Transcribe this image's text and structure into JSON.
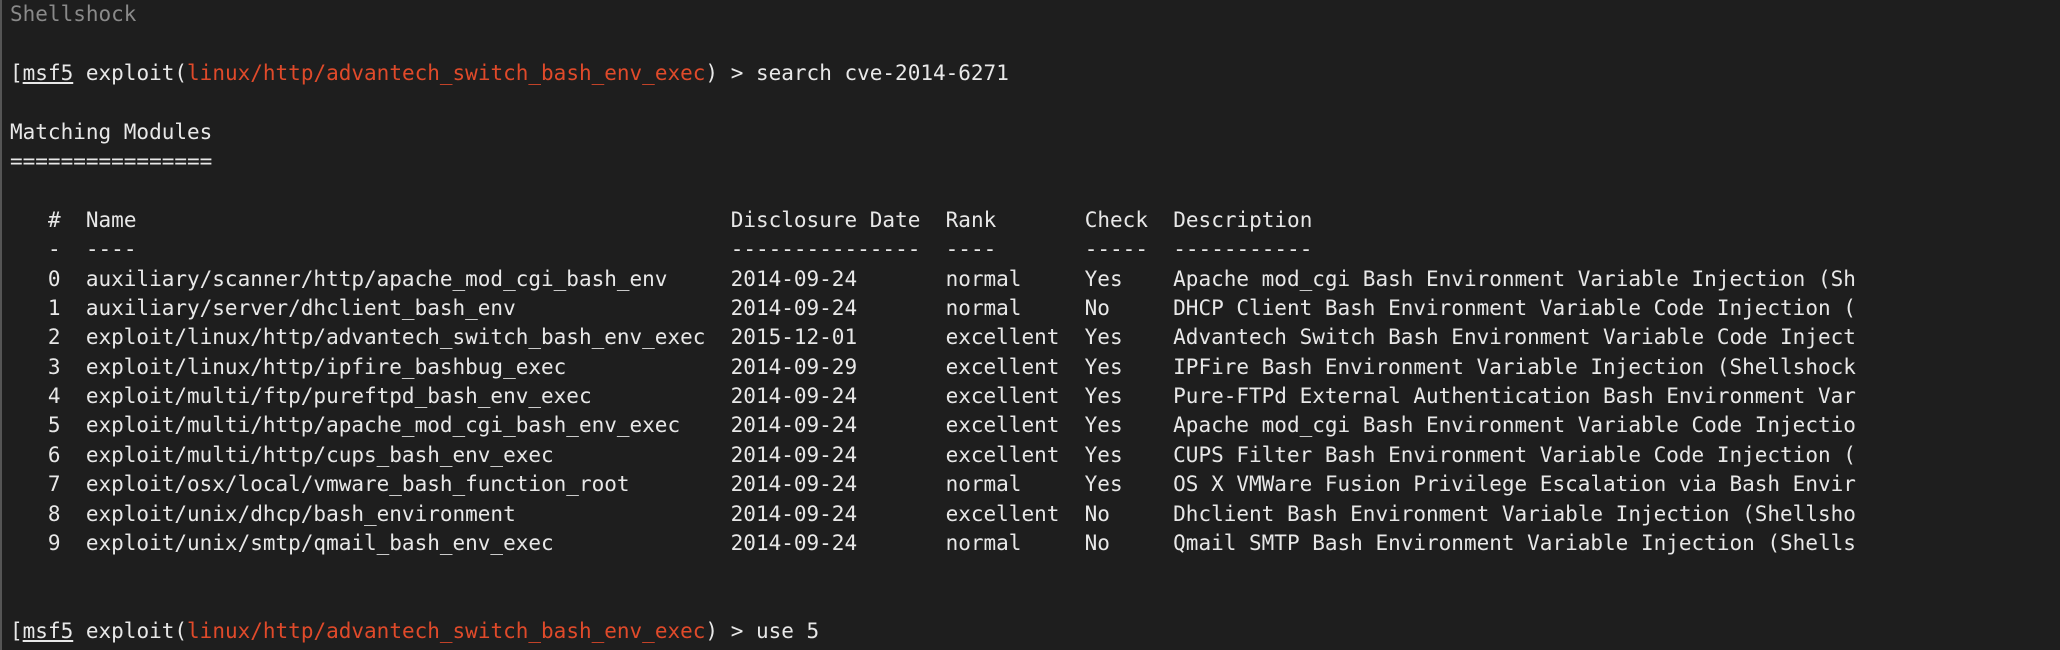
{
  "prev_output_tail": "  Shellshock",
  "prompt1": {
    "bracket_open": "[",
    "msf": "msf5",
    "exploit": " exploit(",
    "path": "linux/http/advantech_switch_bash_env_exec",
    "close": ") > ",
    "command": "search cve-2014-6271"
  },
  "heading": "Matching Modules",
  "heading_underline": "================",
  "columns": {
    "idx_header": "#",
    "idx_underline": "-",
    "name_header": "Name",
    "name_underline": "----",
    "date_header": "Disclosure Date",
    "date_underline": "---------------",
    "rank_header": "Rank",
    "rank_underline": "----",
    "check_header": "Check",
    "check_underline": "-----",
    "desc_header": "Description",
    "desc_underline": "-----------"
  },
  "rows": [
    {
      "idx": "0",
      "name": "auxiliary/scanner/http/apache_mod_cgi_bash_env",
      "date": "2014-09-24",
      "rank": "normal",
      "check": "Yes",
      "desc": "Apache mod_cgi Bash Environment Variable Injection (Sh"
    },
    {
      "idx": "1",
      "name": "auxiliary/server/dhclient_bash_env",
      "date": "2014-09-24",
      "rank": "normal",
      "check": "No",
      "desc": "DHCP Client Bash Environment Variable Code Injection ("
    },
    {
      "idx": "2",
      "name": "exploit/linux/http/advantech_switch_bash_env_exec",
      "date": "2015-12-01",
      "rank": "excellent",
      "check": "Yes",
      "desc": "Advantech Switch Bash Environment Variable Code Inject"
    },
    {
      "idx": "3",
      "name": "exploit/linux/http/ipfire_bashbug_exec",
      "date": "2014-09-29",
      "rank": "excellent",
      "check": "Yes",
      "desc": "IPFire Bash Environment Variable Injection (Shellshock"
    },
    {
      "idx": "4",
      "name": "exploit/multi/ftp/pureftpd_bash_env_exec",
      "date": "2014-09-24",
      "rank": "excellent",
      "check": "Yes",
      "desc": "Pure-FTPd External Authentication Bash Environment Var"
    },
    {
      "idx": "5",
      "name": "exploit/multi/http/apache_mod_cgi_bash_env_exec",
      "date": "2014-09-24",
      "rank": "excellent",
      "check": "Yes",
      "desc": "Apache mod_cgi Bash Environment Variable Code Injectio"
    },
    {
      "idx": "6",
      "name": "exploit/multi/http/cups_bash_env_exec",
      "date": "2014-09-24",
      "rank": "excellent",
      "check": "Yes",
      "desc": "CUPS Filter Bash Environment Variable Code Injection ("
    },
    {
      "idx": "7",
      "name": "exploit/osx/local/vmware_bash_function_root",
      "date": "2014-09-24",
      "rank": "normal",
      "check": "Yes",
      "desc": "OS X VMWare Fusion Privilege Escalation via Bash Envir"
    },
    {
      "idx": "8",
      "name": "exploit/unix/dhcp/bash_environment",
      "date": "2014-09-24",
      "rank": "excellent",
      "check": "No",
      "desc": "Dhclient Bash Environment Variable Injection (Shellsho"
    },
    {
      "idx": "9",
      "name": "exploit/unix/smtp/qmail_bash_env_exec",
      "date": "2014-09-24",
      "rank": "normal",
      "check": "No",
      "desc": "Qmail SMTP Bash Environment Variable Injection (Shells"
    }
  ],
  "prompt2": {
    "bracket_open": "[",
    "msf": "msf5",
    "exploit": " exploit(",
    "path": "linux/http/advantech_switch_bash_env_exec",
    "close": ") > ",
    "command": "use 5"
  }
}
